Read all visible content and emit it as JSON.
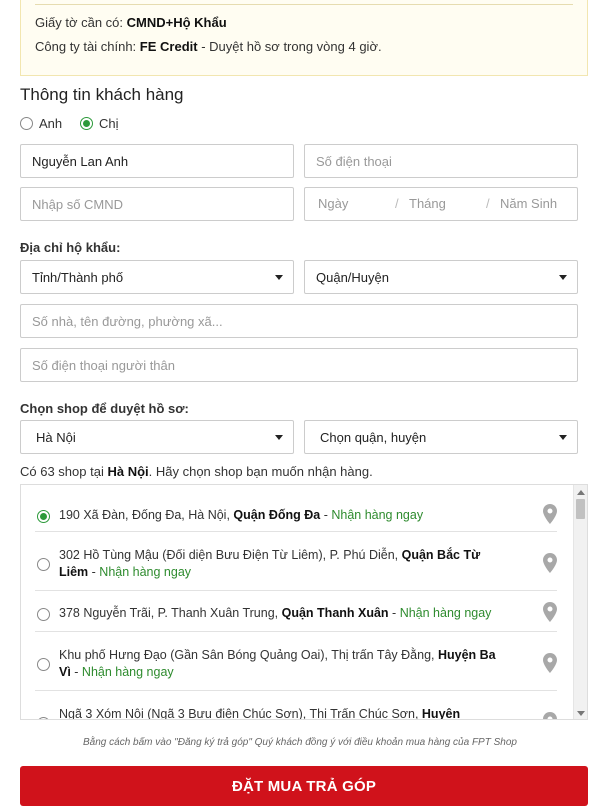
{
  "info": {
    "documents_label": "Giấy tờ cần có:",
    "documents_value": "CMND+Hộ Khẩu",
    "finance_label": "Công ty tài chính:",
    "finance_value": "FE Credit",
    "finance_note": "- Duyệt hồ sơ trong vòng 4 giờ."
  },
  "customer": {
    "title": "Thông tin khách hàng",
    "gender_options": [
      {
        "label": "Anh",
        "checked": false
      },
      {
        "label": "Chị",
        "checked": true
      }
    ],
    "name_value": "Nguyễn Lan Anh",
    "phone_placeholder": "Số điện thoại",
    "id_placeholder": "Nhập số CMND",
    "dob": {
      "day": "Ngày",
      "month": "Tháng",
      "year": "Năm Sinh",
      "separator": "/"
    }
  },
  "address": {
    "label": "Địa chỉ hộ khẩu:",
    "province_value": "Tỉnh/Thành phố",
    "district_value": "Quận/Huyện",
    "street_placeholder": "Số nhà, tên đường, phường xã...",
    "relative_phone_placeholder": "Số điện thoại người thân"
  },
  "shop": {
    "label": "Chọn shop để duyệt hồ sơ:",
    "city_value": "Hà Nội",
    "district_value": "Chọn quận, huyện",
    "count_prefix": "Có 63 shop tại",
    "count_city": "Hà Nội",
    "count_suffix": ". Hãy chọn shop bạn muốn nhận hàng.",
    "items": [
      {
        "address": "190 Xã Đàn, Đống Đa, Hà Nội,",
        "district": "Quận Đống Đa",
        "availability": "Nhận hàng ngay",
        "selected": true
      },
      {
        "address": "302 Hồ Tùng Mậu (Đối diện Bưu Điện Từ Liêm), P. Phú Diễn,",
        "district": "Quận Bắc Từ Liêm",
        "availability": "Nhận hàng ngay",
        "selected": false
      },
      {
        "address": "378 Nguyễn Trãi, P. Thanh Xuân Trung,",
        "district": "Quận Thanh Xuân",
        "availability": "Nhận hàng ngay",
        "selected": false
      },
      {
        "address": "Khu phố Hưng Đạo (Gần Sân Bóng Quảng Oai), Thị trấn Tây Đằng,",
        "district": "Huyện Ba Vì",
        "availability": "Nhận hàng ngay",
        "selected": false
      },
      {
        "address": "Ngã 3 Xóm Nội (Ngã 3 Bưu điện Chúc Sơn), Thị Trấn Chúc Sơn,",
        "district": "Huyện Chương Mỹ",
        "availability": "",
        "selected": false
      }
    ]
  },
  "terms": "Bằng cách bấm vào \"Đăng ký trả góp\" Quý khách đồng ý với điều khoản mua hàng của FPT Shop",
  "submit_label": "ĐẶT MUA TRẢ GÓP",
  "colors": {
    "accent_red": "#d0121b",
    "accent_green": "#2c9a3a",
    "availability_green": "#2e8b2e",
    "pin_gray": "#a8a8a8"
  },
  "icons": {
    "location": "map-pin-icon",
    "dropdown": "chevron-down-icon"
  }
}
